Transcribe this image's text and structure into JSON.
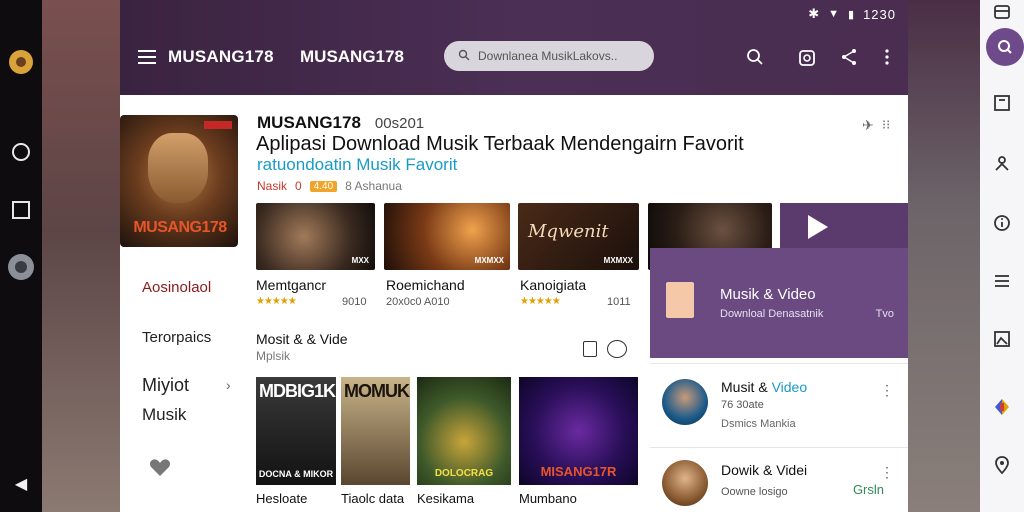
{
  "status": {
    "time": "1230"
  },
  "header": {
    "brand": "MUSANG178",
    "brand2": "MUSANG178",
    "search_placeholder": "Downlanea MusikLakovs.."
  },
  "cover": {
    "title": "MUSANG178"
  },
  "app": {
    "name": "MUSANG178",
    "code": "00s201",
    "title": "Aplipasi Download Musik Terbaak  Mendengairn Favorit",
    "subtitle": "ratuondoatin Musik Favorit",
    "meta_label": "Nasik",
    "meta_num": "0",
    "meta_pill": "4.40",
    "meta_count": "8 Ashanua"
  },
  "sidenav": {
    "items": [
      "Aosinolaol",
      "Terorpaics",
      "Miyiot",
      "Musik"
    ]
  },
  "row1": {
    "thumb_script": "Mqwenit",
    "items": [
      {
        "name": "Memtgancr",
        "stars": "★★★★★",
        "num": "9010",
        "tag": "MXX"
      },
      {
        "name": "Roemichand",
        "stars": "",
        "num": "20x0c0  A010",
        "tag": "MXMXX"
      },
      {
        "name": "Kanoigiata",
        "stars": "★★★★★",
        "num": "1011",
        "tag": "MXMXX"
      }
    ]
  },
  "section": {
    "title": "Mosit & & Vide",
    "subtitle": "Mplsik"
  },
  "row2": {
    "items": [
      {
        "name": "Hesloate",
        "top": "MDBIG1K",
        "bottom": "DOCNA & MIKOR"
      },
      {
        "name": "Tiaolc data",
        "top": "MOMUK",
        "bottom": ""
      },
      {
        "name": "Kesikama",
        "top": "",
        "bottom": "DOLOCRAG"
      },
      {
        "name": "Mumbano",
        "top": "",
        "bottom": "MISANG17R"
      }
    ]
  },
  "right_panel": {
    "card": {
      "title": "Musik & Video",
      "sub": "Downloal Denasatnik",
      "right": "Tvo"
    },
    "rows": [
      {
        "title_a": "Musit & ",
        "title_b": "Video",
        "sub": "76 30ate",
        "sub2": "Dsmics Mankia",
        "action": ""
      },
      {
        "title_a": "Dowik & Videi",
        "title_b": "",
        "sub": "Oowne losigo",
        "sub2": "",
        "action": "Grsln"
      }
    ]
  },
  "colors": {
    "topbar": "#4b2f55",
    "accent": "#6b4a82",
    "link": "#1a9bc6"
  }
}
